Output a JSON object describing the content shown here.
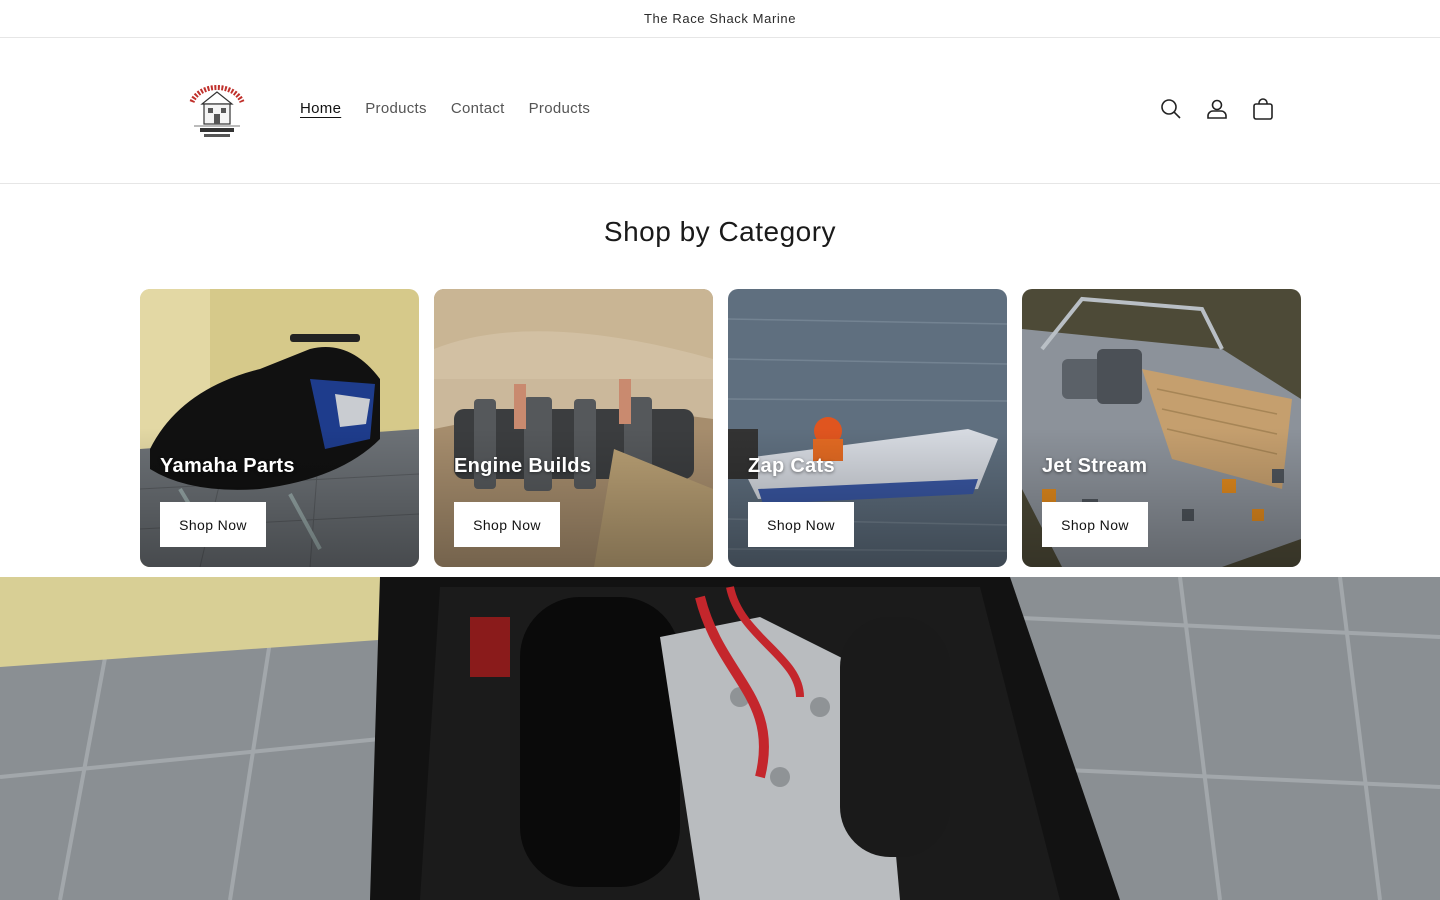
{
  "announcement": {
    "text": "The Race Shack Marine"
  },
  "header": {
    "logo_alt": "The Race Shack logo",
    "nav": [
      {
        "label": "Home",
        "active": true
      },
      {
        "label": "Products",
        "active": false
      },
      {
        "label": "Contact",
        "active": false
      },
      {
        "label": "Products",
        "active": false
      }
    ],
    "icons": [
      "search-icon",
      "account-icon",
      "cart-icon"
    ]
  },
  "section": {
    "title": "Shop by Category"
  },
  "categories": [
    {
      "title": "Yamaha Parts",
      "button": "Shop Now"
    },
    {
      "title": "Engine Builds",
      "button": "Shop Now"
    },
    {
      "title": "Zap Cats",
      "button": "Shop Now"
    },
    {
      "title": "Jet Stream",
      "button": "Shop Now"
    }
  ],
  "colors": {
    "border": "#e6e6e6",
    "text": "#121212",
    "muted": "#555555"
  }
}
